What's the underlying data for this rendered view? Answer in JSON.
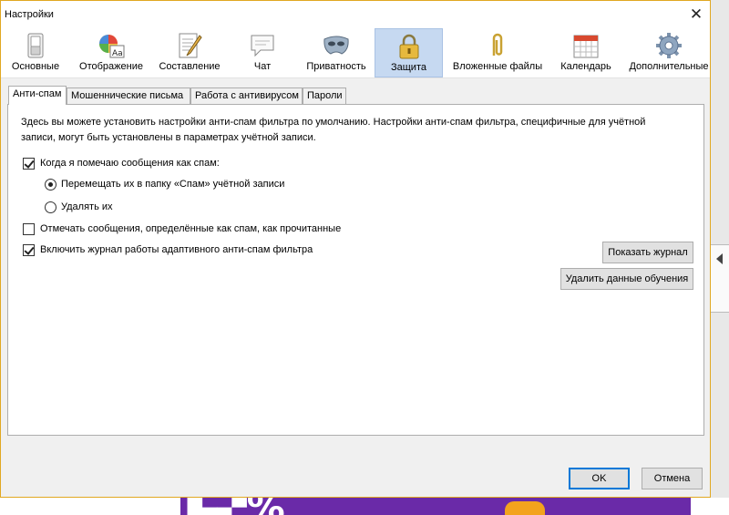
{
  "window": {
    "title": "Настройки",
    "close_glyph": "✕"
  },
  "toolbar": {
    "items": [
      {
        "label": "Основные",
        "icon": "switch-icon"
      },
      {
        "label": "Отображение",
        "icon": "palette-icon"
      },
      {
        "label": "Составление",
        "icon": "compose-icon"
      },
      {
        "label": "Чат",
        "icon": "chat-icon"
      },
      {
        "label": "Приватность",
        "icon": "mask-icon"
      },
      {
        "label": "Защита",
        "icon": "lock-icon",
        "selected": true
      },
      {
        "label": "Вложенные файлы",
        "icon": "paperclip-icon"
      },
      {
        "label": "Календарь",
        "icon": "calendar-icon"
      },
      {
        "label": "Дополнительные",
        "icon": "gear-icon"
      }
    ]
  },
  "tabs": [
    {
      "label": "Анти-спам",
      "selected": true
    },
    {
      "label": "Мошеннические письма"
    },
    {
      "label": "Работа с антивирусом"
    },
    {
      "label": "Пароли"
    }
  ],
  "antispam": {
    "description_line1": "Здесь вы можете установить настройки анти-спам фильтра по умолчанию. Настройки анти-спам фильтра, специфичные для учётной",
    "description_line2": "записи, могут быть установлены в параметрах учётной записи.",
    "mark_as_spam_label": "Когда я помечаю сообщения как спам:",
    "mark_as_spam_checked": true,
    "move_label": "Перемещать их в папку «Спам» учётной записи",
    "move_selected": true,
    "delete_label": "Удалять их",
    "delete_selected": false,
    "mark_read_label": "Отмечать сообщения, определённые как спам, как прочитанные",
    "mark_read_checked": false,
    "enable_log_label": "Включить журнал работы адаптивного анти-спам фильтра",
    "enable_log_checked": true,
    "show_log_button": "Показать журнал",
    "reset_training_button": "Удалить данные обучения"
  },
  "footer": {
    "ok_button": "OK",
    "cancel_button": "Отмена"
  },
  "colors": {
    "selected_toolbar_bg": "#c6d9f1",
    "window_border": "#e1a822",
    "default_button_border": "#0078d7"
  }
}
